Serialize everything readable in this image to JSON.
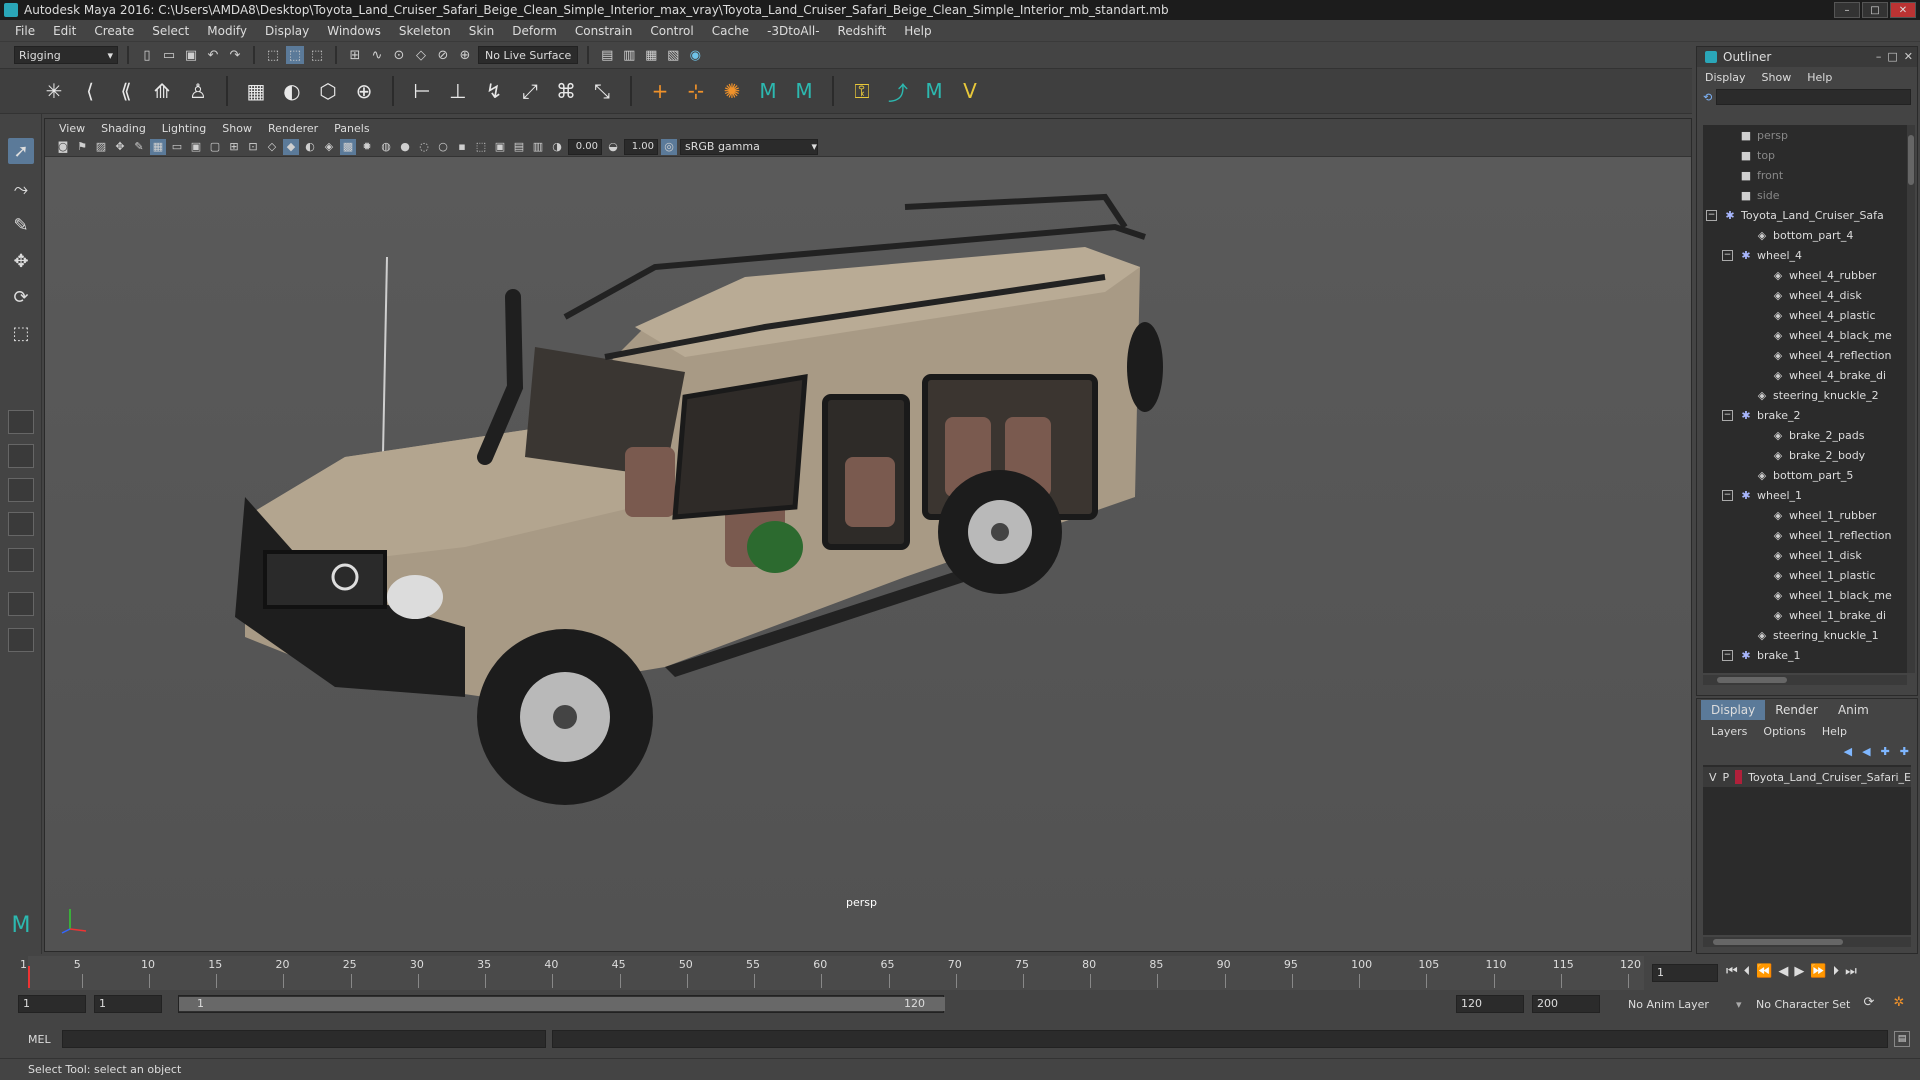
{
  "window": {
    "title": "Autodesk Maya 2016: C:\\Users\\AMDA8\\Desktop\\Toyota_Land_Cruiser_Safari_Beige_Clean_Simple_Interior_max_vray\\Toyota_Land_Cruiser_Safari_Beige_Clean_Simple_Interior_mb_standart.mb"
  },
  "menubar": [
    "File",
    "Edit",
    "Create",
    "Select",
    "Modify",
    "Display",
    "Windows",
    "Skeleton",
    "Skin",
    "Deform",
    "Constrain",
    "Control",
    "Cache",
    "-3DtoAll-",
    "Redshift",
    "Help"
  ],
  "statusline": {
    "mode": "Rigging",
    "live_surface": "No Live Surface"
  },
  "viewport": {
    "panel_menu": [
      "View",
      "Shading",
      "Lighting",
      "Show",
      "Renderer",
      "Panels"
    ],
    "exposure": "0.00",
    "gamma": "1.00",
    "color_space": "sRGB gamma",
    "camera": "persp"
  },
  "outliner": {
    "title": "Outliner",
    "menu": [
      "Display",
      "Show",
      "Help"
    ],
    "items": [
      {
        "label": "persp",
        "depth": 1,
        "icon": "camera-icon",
        "dim": true
      },
      {
        "label": "top",
        "depth": 1,
        "icon": "camera-icon",
        "dim": true
      },
      {
        "label": "front",
        "depth": 1,
        "icon": "camera-icon",
        "dim": true
      },
      {
        "label": "side",
        "depth": 1,
        "icon": "camera-icon",
        "dim": true
      },
      {
        "label": "Toyota_Land_Cruiser_Safa",
        "depth": 0,
        "icon": "joint-icon",
        "expand": "−"
      },
      {
        "label": "bottom_part_4",
        "depth": 2,
        "icon": "mesh-icon"
      },
      {
        "label": "wheel_4",
        "depth": 1,
        "icon": "joint-icon",
        "expand": "−"
      },
      {
        "label": "wheel_4_rubber",
        "depth": 3,
        "icon": "mesh-icon"
      },
      {
        "label": "wheel_4_disk",
        "depth": 3,
        "icon": "mesh-icon"
      },
      {
        "label": "wheel_4_plastic",
        "depth": 3,
        "icon": "mesh-icon"
      },
      {
        "label": "wheel_4_black_me",
        "depth": 3,
        "icon": "mesh-icon"
      },
      {
        "label": "wheel_4_reflection",
        "depth": 3,
        "icon": "mesh-icon"
      },
      {
        "label": "wheel_4_brake_di",
        "depth": 3,
        "icon": "mesh-icon"
      },
      {
        "label": "steering_knuckle_2",
        "depth": 2,
        "icon": "mesh-icon"
      },
      {
        "label": "brake_2",
        "depth": 1,
        "icon": "joint-icon",
        "expand": "−"
      },
      {
        "label": "brake_2_pads",
        "depth": 3,
        "icon": "mesh-icon"
      },
      {
        "label": "brake_2_body",
        "depth": 3,
        "icon": "mesh-icon"
      },
      {
        "label": "bottom_part_5",
        "depth": 2,
        "icon": "mesh-icon"
      },
      {
        "label": "wheel_1",
        "depth": 1,
        "icon": "joint-icon",
        "expand": "−"
      },
      {
        "label": "wheel_1_rubber",
        "depth": 3,
        "icon": "mesh-icon"
      },
      {
        "label": "wheel_1_reflection",
        "depth": 3,
        "icon": "mesh-icon"
      },
      {
        "label": "wheel_1_disk",
        "depth": 3,
        "icon": "mesh-icon"
      },
      {
        "label": "wheel_1_plastic",
        "depth": 3,
        "icon": "mesh-icon"
      },
      {
        "label": "wheel_1_black_me",
        "depth": 3,
        "icon": "mesh-icon"
      },
      {
        "label": "wheel_1_brake_di",
        "depth": 3,
        "icon": "mesh-icon"
      },
      {
        "label": "steering_knuckle_1",
        "depth": 2,
        "icon": "mesh-icon"
      },
      {
        "label": "brake_1",
        "depth": 1,
        "icon": "joint-icon",
        "expand": "−"
      }
    ]
  },
  "layers": {
    "tabs": [
      "Display",
      "Render",
      "Anim"
    ],
    "active_tab": "Display",
    "menu": [
      "Layers",
      "Options",
      "Help"
    ],
    "rows": [
      {
        "v": "V",
        "p": "P",
        "name": "Toyota_Land_Cruiser_Safari_E",
        "color": "#b0203a"
      }
    ]
  },
  "timeslider": {
    "ticks": [
      "1",
      "5",
      "10",
      "15",
      "20",
      "25",
      "30",
      "35",
      "40",
      "45",
      "50",
      "55",
      "60",
      "65",
      "70",
      "75",
      "80",
      "85",
      "90",
      "95",
      "100",
      "105",
      "110",
      "115",
      "120"
    ],
    "current_frame": "1"
  },
  "rangeslider": {
    "start": "1",
    "playback_start": "1",
    "range_start": "1",
    "range_end": "120",
    "playback_end": "120",
    "end": "200",
    "anim_layer": "No Anim Layer",
    "character_set": "No Character Set"
  },
  "cmdline": {
    "label": "MEL"
  },
  "helpline": {
    "text": "Select Tool: select an object"
  },
  "colors": {
    "accent": "#5b7a99",
    "layer_red": "#b0203a",
    "maya_teal": "#2aa6b8"
  }
}
